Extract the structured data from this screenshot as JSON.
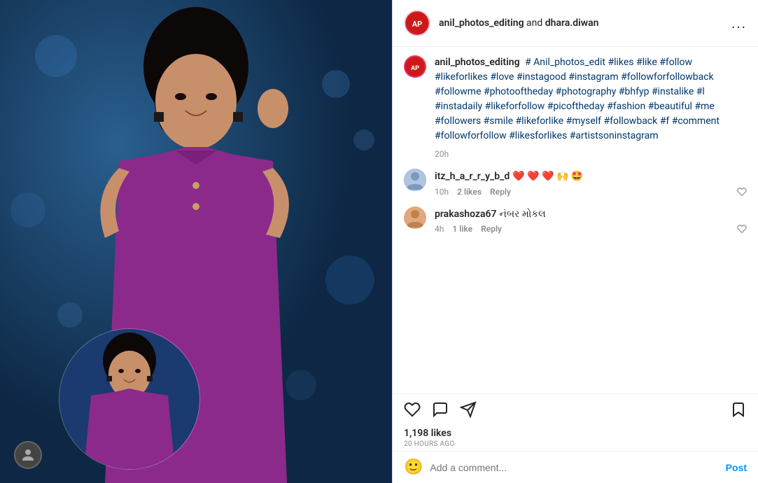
{
  "header": {
    "username": "anil_photos_editing",
    "collab_text": " and ",
    "collab_user": "dhara.diwan",
    "more_options": "..."
  },
  "caption": {
    "username": "anil_photos_editing",
    "text": "# Anil_photos_edit #likes #like #follow #likeforlikes #love #instagood #instagram #followforfollowback #followme #photooftheday #photography #bhfyp #instalike #l #instadaily #likeforfollow #picoftheday #fashion #beautiful #me #followers #smile #likeforlike #myself #followback #f #comment #followforfollow #likesforlikes #artistsoninstagram",
    "timestamp": "20h"
  },
  "comments": [
    {
      "username": "itz_h_a_r_r_y_b_d",
      "text": "❤️ ❤️ ❤️ 🙌 🤩",
      "time": "10h",
      "likes": "2 likes",
      "reply": "Reply"
    },
    {
      "username": "prakashoza67",
      "text": "નંબર મોકલ",
      "time": "4h",
      "likes": "1 like",
      "reply": "Reply"
    }
  ],
  "actions": {
    "like_label": "like-icon",
    "comment_label": "comment-icon",
    "share_label": "share-icon",
    "bookmark_label": "bookmark-icon"
  },
  "likes": {
    "count": "1,198 likes",
    "time_ago": "20 HOURS AGO"
  },
  "comment_input": {
    "placeholder": "Add a comment...",
    "post_label": "Post"
  }
}
